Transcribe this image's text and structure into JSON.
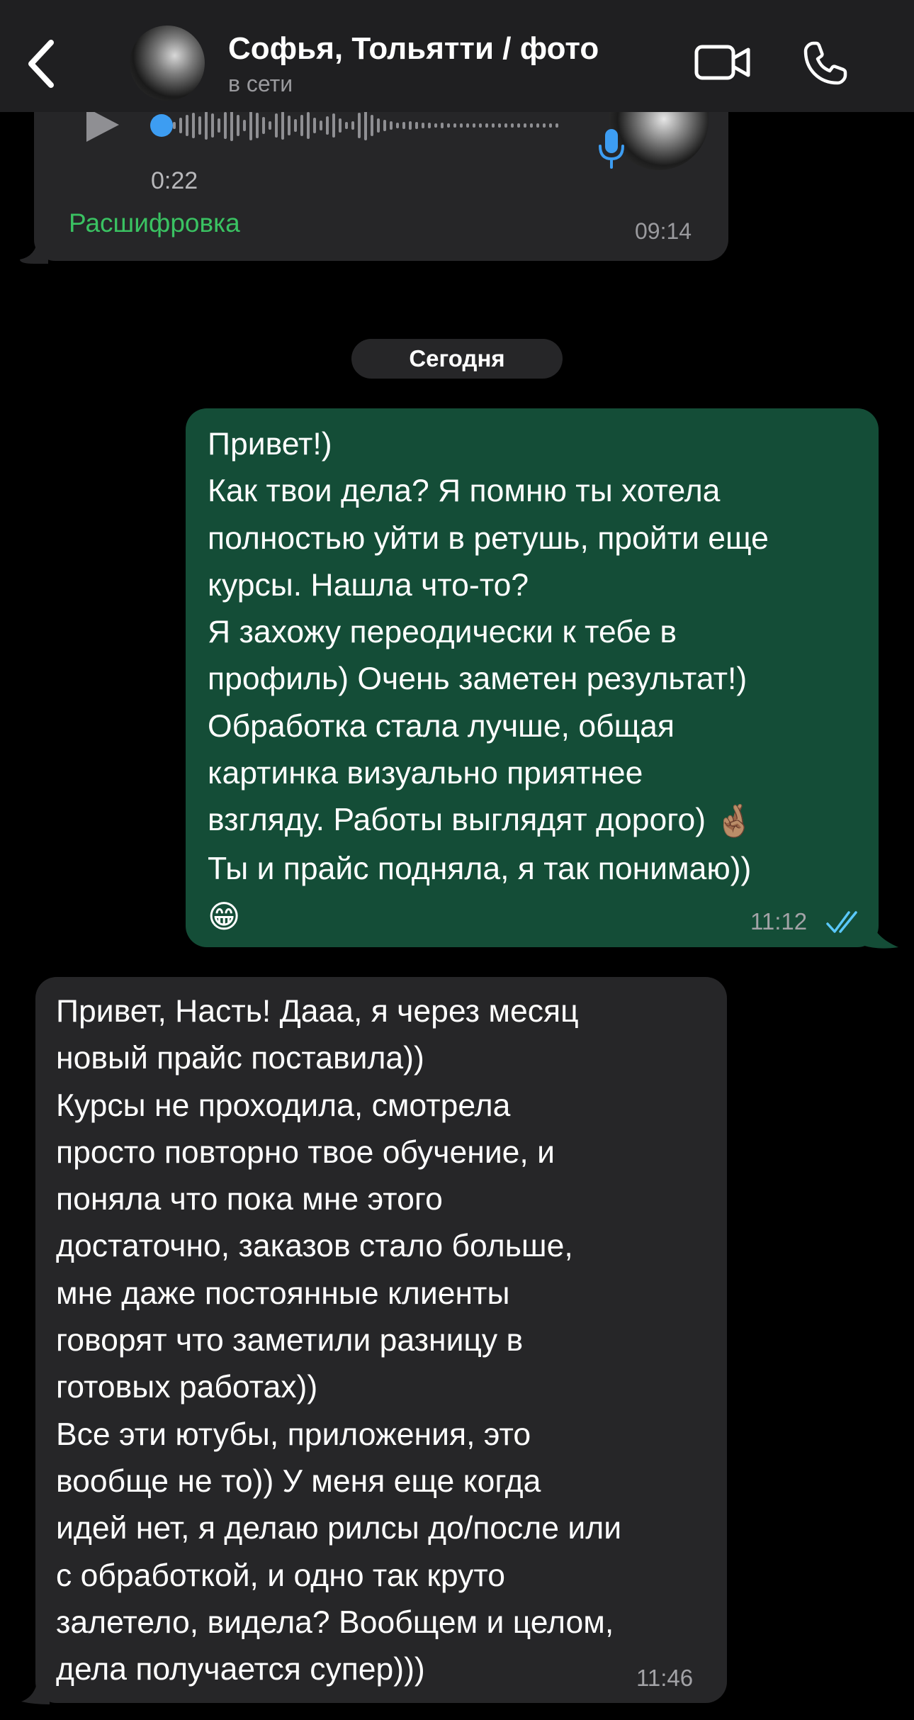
{
  "header": {
    "contact_name": "Софья, Тольятти / фото",
    "status": "в сети",
    "back_icon": "chevron-left-icon",
    "video_icon": "video-camera-icon",
    "call_icon": "phone-icon"
  },
  "voice_message": {
    "duration": "0:22",
    "transcribe_label": "Расшифровка",
    "time": "09:14",
    "progress": 0.0
  },
  "date_separator": "Сегодня",
  "outgoing_message": {
    "lines": [
      "Привет!)",
      "Как твои дела? Я помню ты хотела",
      "полностью уйти в ретушь, пройти еще",
      "курсы. Нашла что-то?",
      "Я захожу переодически к тебе в",
      "профиль) Очень заметен результат!)",
      "Обработка стала лучше, общая",
      "картинка визуально приятнее",
      "взгляду. Работы выглядят дорого)",
      "Ты и прайс подняла, я так понимаю))"
    ],
    "emoji_1": "🤞🏽",
    "emoji_2": "😁",
    "time": "11:12",
    "status": "read"
  },
  "incoming_message": {
    "lines": [
      "Привет, Насть! Дааа, я через месяц",
      "новый прайс поставила))",
      "Курсы не проходила, смотрела",
      "просто повторно твое обучение, и",
      "поняла что пока мне этого",
      "достаточно, заказов стало больше,",
      "мне даже постоянные клиенты",
      "говорят что заметили разницу в",
      "готовых работах))",
      "Все эти ютубы, приложения, это",
      "вообще не то)) У меня еще когда",
      "идей нет, я делаю рилсы до/после или",
      "с обработкой, и одно так круто",
      "залетело, видела? Вообщем и целом,",
      "дела получается супер)))"
    ],
    "time": "11:46"
  },
  "colors": {
    "background": "#000000",
    "header": "#1f1f21",
    "incoming_bubble": "#262628",
    "outgoing_bubble": "#144d37",
    "accent_green": "#3ac262",
    "read_check_blue": "#5ac8fa",
    "voice_progress_blue": "#3d9df2"
  }
}
